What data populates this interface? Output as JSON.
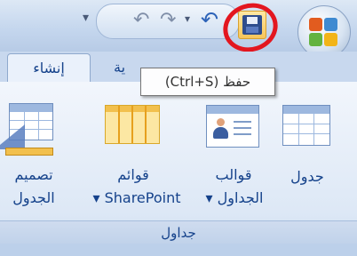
{
  "tooltip": {
    "text": "حفظ (Ctrl+S)"
  },
  "tabs": [
    {
      "label": "إنشاء"
    },
    {
      "label": "ية"
    }
  ],
  "ribbon": {
    "group_label": "جداول",
    "buttons": [
      {
        "line1": "جدول",
        "line2": ""
      },
      {
        "line1": "قوالب",
        "line2": "الجداول ▾"
      },
      {
        "line1": "قوائم",
        "line2": "▾ SharePoint"
      },
      {
        "line1": "تصميم",
        "line2": "الجدول"
      }
    ]
  },
  "qat": {
    "save_icon": "save-icon",
    "undo_icon": "undo-icon",
    "redo_icon": "redo-icon"
  },
  "colors": {
    "accent": "#15428b",
    "highlight_ring": "#e3161f"
  }
}
